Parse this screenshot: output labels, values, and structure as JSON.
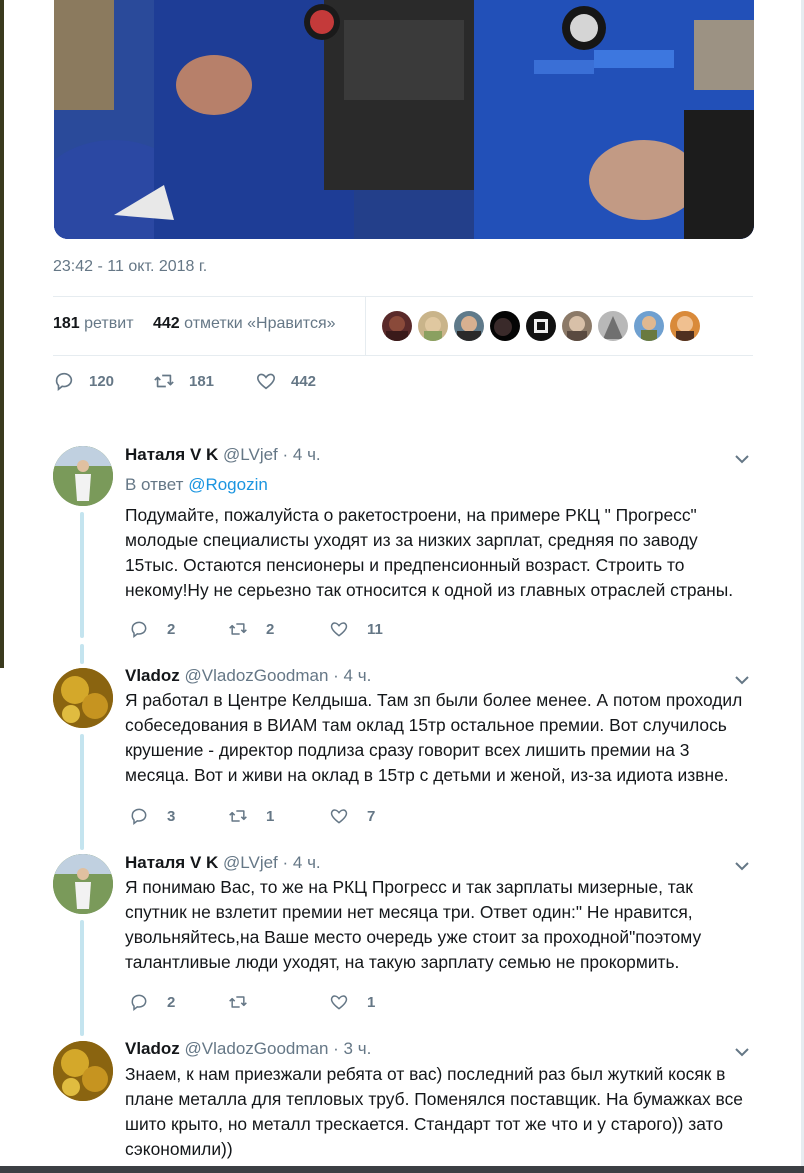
{
  "tweet": {
    "timestamp": "23:42 - 11 окт. 2018 г.",
    "retweets_count": "181",
    "retweets_label": "ретвит",
    "likes_count": "442",
    "likes_label": "отметки «Нравится»",
    "actions": {
      "replies": "120",
      "retweets": "181",
      "likes": "442"
    }
  },
  "replies": [
    {
      "name": "Наталя V K",
      "handle": "@LVjef",
      "time": "· 4 ч.",
      "in_reply_prefix": "В ответ",
      "in_reply_mention": "@Rogozin",
      "lines": [
        "Подумайте, пожалуйста о ракетостроени, на примере РКЦ \" Прогресс\"",
        "молодые специалисты уходят из за низких зарплат, средняя по заводу",
        "15тыс. Остаются пенсионеры и предпенсионный возраст. Строить то",
        "некому!Ну не серьезно так относится к одной из главных отраслей страны."
      ],
      "replies_count": "2",
      "retweets_count": "2",
      "likes_count": "11"
    },
    {
      "name": "Vladoz",
      "handle": "@VladozGoodman",
      "time": "· 4 ч.",
      "lines": [
        "Я работал в Центре Келдыша. Там зп были более менее. А потом проходил",
        "собеседования в ВИАМ там оклад 15тр остальное премии. Вот случилось",
        "крушение - директор подлиза сразу говорит всех лишить премии на 3",
        "месяца. Вот и живи на оклад в 15тр с детьми и женой, из-за идиота извне."
      ],
      "replies_count": "3",
      "retweets_count": "1",
      "likes_count": "7"
    },
    {
      "name": "Наталя V K",
      "handle": "@LVjef",
      "time": "· 4 ч.",
      "lines": [
        "Я понимаю Вас, то же на РКЦ Прогресс и так зарплаты мизерные, так",
        "спутник не взлетит премии нет месяца три. Ответ один:\" Не нравится,",
        "увольняйтесь,на Ваше место очередь уже стоит за проходной\"поэтому",
        "талантливые люди уходят, на такую зарплату семью не прокормить."
      ],
      "replies_count": "2",
      "retweets_count": "",
      "likes_count": "1"
    },
    {
      "name": "Vladoz",
      "handle": "@VladozGoodman",
      "time": "· 3 ч.",
      "lines": [
        "Знаем, к нам приезжали ребята от вас) последний раз был жуткий косяк в",
        "плане металла для тепловых труб. Поменялся поставщик. На бумажках все",
        "шито крыто, но металл трескается. Стандарт тот же что и у старого)) зато",
        "сэкономили))"
      ]
    }
  ],
  "colors": {
    "text": "#14171a",
    "muted": "#657786",
    "link": "#1b95e0",
    "thread": "#c4e4ef"
  },
  "icons": {
    "reply": "reply-icon",
    "retweet": "retweet-icon",
    "like": "heart-icon",
    "more": "chevron-down-icon"
  }
}
